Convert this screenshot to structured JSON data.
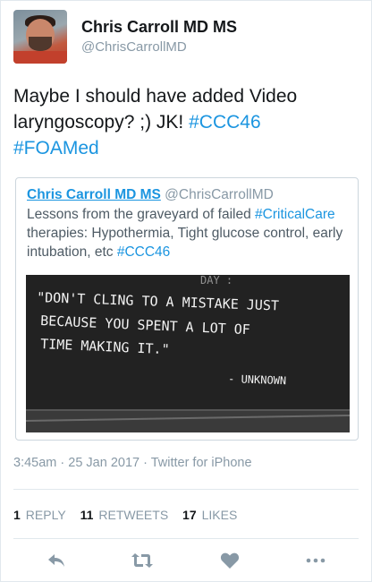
{
  "user": {
    "name": "Chris Carroll MD MS",
    "handle": "@ChrisCarrollMD"
  },
  "tweet": {
    "text_plain": "Maybe I should have added Video laryngoscopy? ;) JK! ",
    "tag1": "#CCC46",
    "tag2": "#FOAMed"
  },
  "quoted": {
    "name": "Chris Carroll MD MS",
    "handle": "@ChrisCarrollMD",
    "text_a": "Lessons from the graveyard of failed ",
    "tag_a": "#CriticalCare",
    "text_b": " therapies: Hypothermia, Tight glucose control, early intubation, etc ",
    "tag_b": "#CCC46",
    "image": {
      "line1": "\"DON'T  CLING  TO A MISTAKE  JUST",
      "line2": "BECAUSE YOU SPENT  A  LOT  OF",
      "line3": "TIME  MAKING  IT.\"",
      "attribution": "- UNKNOWN",
      "top_scrawl": "DAY :"
    }
  },
  "meta": {
    "timestamp": "3:45am · 25 Jan 2017 · Twitter for iPhone"
  },
  "stats": {
    "replies_count": "1",
    "replies_label": "REPLY",
    "retweets_count": "11",
    "retweets_label": "RETWEETS",
    "likes_count": "17",
    "likes_label": "LIKES"
  },
  "colors": {
    "link": "#1b95e0",
    "muted": "#8899a6",
    "icon": "#8899a6"
  },
  "icons": [
    "reply-icon",
    "retweet-icon",
    "like-icon",
    "more-icon"
  ]
}
